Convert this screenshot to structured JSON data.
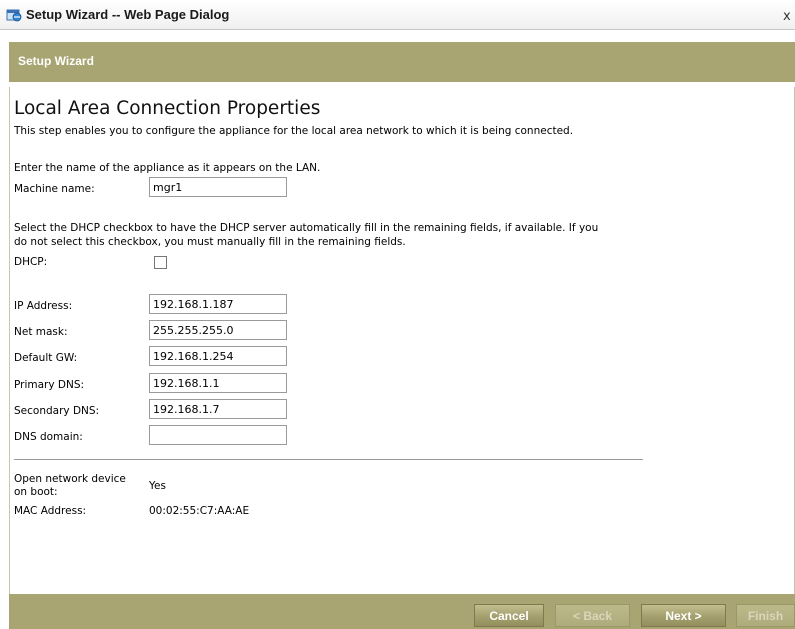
{
  "window": {
    "title": "Setup Wizard -- Web Page Dialog",
    "close_glyph": "x"
  },
  "wizard": {
    "header_title": "Setup Wizard"
  },
  "page": {
    "title": "Local Area Connection Properties",
    "description": "This step enables you to configure the appliance for the local area network to which it is being connected."
  },
  "lan_section": {
    "instruction": "Enter the name of the appliance as it appears on the LAN.",
    "machine_name_label": "Machine name:",
    "machine_name_value": "mgr1"
  },
  "dhcp_section": {
    "instruction_line1": "Select the DHCP checkbox to have the DHCP server automatically fill in the remaining fields, if available. If you",
    "instruction_line2": "do not select this checkbox, you must manually fill in the remaining fields.",
    "dhcp_label": "DHCP:",
    "dhcp_checked": false
  },
  "network": {
    "ip_label": "IP Address:",
    "ip_value": "192.168.1.187",
    "netmask_label": "Net mask:",
    "netmask_value": "255.255.255.0",
    "gateway_label": "Default GW:",
    "gateway_value": "192.168.1.254",
    "primary_dns_label": "Primary DNS:",
    "primary_dns_value": "192.168.1.1",
    "secondary_dns_label": "Secondary DNS:",
    "secondary_dns_value": "192.168.1.7",
    "dns_domain_label": "DNS domain:",
    "dns_domain_value": ""
  },
  "device": {
    "open_on_boot_label_line1": "Open network device",
    "open_on_boot_label_line2": "on boot:",
    "open_on_boot_value": "Yes",
    "mac_label": "MAC Address:",
    "mac_value": "00:02:55:C7:AA:AE"
  },
  "buttons": {
    "cancel": "Cancel",
    "back": "< Back",
    "next": "Next >",
    "finish": "Finish"
  },
  "colors": {
    "header_bar": "#a9a573",
    "button_enabled_text": "#ffffff",
    "button_disabled_text": "#d9d6bd"
  },
  "icons": {
    "window_icon": "ie-dialog-icon"
  }
}
